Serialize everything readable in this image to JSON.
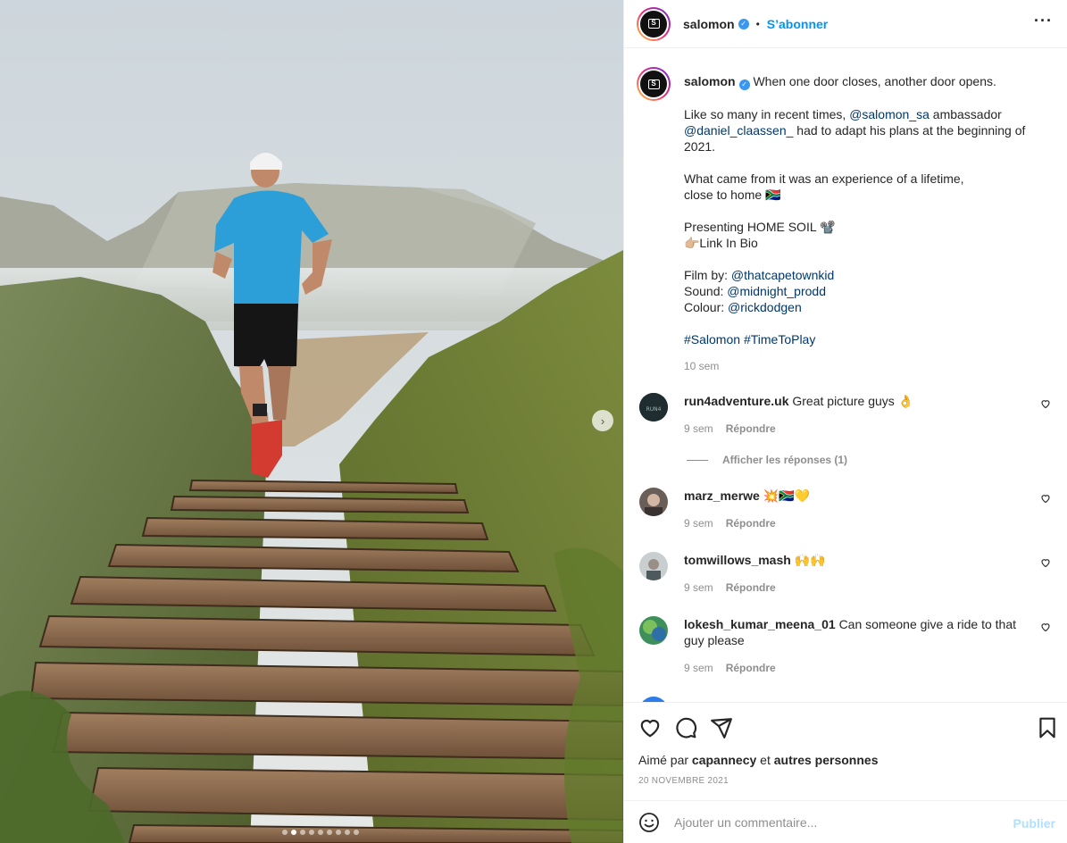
{
  "post": {
    "author": "salomon",
    "follow_label": "S’abonner",
    "separator": "•",
    "more_label": "•••"
  },
  "caption": {
    "author": "salomon",
    "line1": "When one door closes, another door opens.",
    "p2_pre": "Like so many in recent times, ",
    "p2_mention1": "@salomon_sa",
    "p2_mid": " ambassador ",
    "p2_mention2": "@daniel_claassen_",
    "p2_post": " had to adapt his plans at the beginning of 2021.",
    "p3": "What came from it was an experience of a lifetime,",
    "p3b": "close to home 🇿🇦",
    "p4": "Presenting HOME SOIL 📽️",
    "p4b": "👉🏼Link In Bio",
    "film_label": "Film by: ",
    "film_mention": "@thatcapetownkid",
    "sound_label": "Sound: ",
    "sound_mention": "@midnight_prodd",
    "colour_label": "Colour: ",
    "colour_mention": "@rickdodgen",
    "hashtag1": "#Salomon",
    "hashtag2": "#TimeToPlay",
    "time": "10 sem"
  },
  "comments": [
    {
      "user": "run4adventure.uk",
      "text": "Great picture guys 👌",
      "time": "9 sem",
      "reply": "Répondre"
    },
    {
      "user": "marz_merwe",
      "text": "💥🇿🇦💛",
      "time": "9 sem",
      "reply": "Répondre"
    },
    {
      "user": "tomwillows_mash",
      "text": "🙌🙌",
      "time": "9 sem",
      "reply": "Répondre"
    },
    {
      "user": "lokesh_kumar_meena_01",
      "text": "Can someone give a ride to that guy please",
      "time": "9 sem",
      "reply": "Répondre"
    }
  ],
  "view_replies": "Afficher les réponses (1)",
  "likes": {
    "prefix": "Aimé par ",
    "user": "capannecy",
    "conj": " et ",
    "others": "autres personnes"
  },
  "date": "20 NOVEMBRE 2021",
  "comment_box": {
    "placeholder": "Ajouter un commentaire...",
    "publish": "Publier"
  },
  "carousel": {
    "slide_count": 9,
    "active_index": 1
  },
  "colors": {
    "accent": "#0095f6",
    "link": "#00376b",
    "muted": "#8e8e8e",
    "verified": "#3897f0"
  }
}
